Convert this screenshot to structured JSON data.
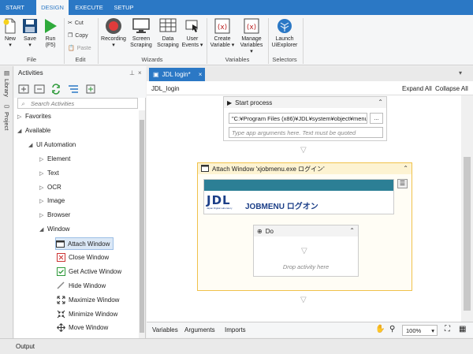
{
  "ribbon_tabs": [
    "START",
    "DESIGN",
    "EXECUTE",
    "SETUP"
  ],
  "active_tab": "DESIGN",
  "ribbon": {
    "new": "New",
    "save": "Save",
    "run_line1": "Run",
    "run_line2": "(F5)",
    "cut": "Cut",
    "copy": "Copy",
    "paste": "Paste",
    "recording": "Recording",
    "screen_scraping_1": "Screen",
    "screen_scraping_2": "Scraping",
    "data_scraping_1": "Data",
    "data_scraping_2": "Scraping",
    "user_events_1": "User",
    "user_events_2": "Events",
    "create_variable_1": "Create",
    "create_variable_2": "Variable",
    "manage_variables_1": "Manage",
    "manage_variables_2": "Variables",
    "launch_1": "Launch",
    "launch_2": "UiExplorer",
    "groups": {
      "file": "File",
      "edit": "Edit",
      "wizards": "Wizards",
      "variables": "Variables",
      "selectors": "Selectors"
    }
  },
  "side_tabs": {
    "library": "Library",
    "project": "Project"
  },
  "activities": {
    "title": "Activities",
    "search_placeholder": "Search Activities",
    "tree": {
      "favorites": "Favorites",
      "available": "Available",
      "ui_automation": "UI Automation",
      "element": "Element",
      "text": "Text",
      "ocr": "OCR",
      "image": "Image",
      "browser": "Browser",
      "window": "Window",
      "attach_window": "Attach Window",
      "close_window": "Close Window",
      "get_active_window": "Get Active Window",
      "hide_window": "Hide Window",
      "maximize_window": "Maximize Window",
      "minimize_window": "Minimize Window",
      "move_window": "Move Window"
    }
  },
  "document": {
    "tab": "JDL login*",
    "breadcrumb": "JDL_login",
    "expand_all": "Expand All",
    "collapse_all": "Collapse All",
    "start_process": {
      "title": "Start process",
      "path": "\"C:¥Program Files (x86)¥JDL¥system¥object¥menu",
      "browse": "...",
      "args_placeholder": "Type app arguments here. Text must be quoted"
    },
    "attach_window": {
      "title": "Attach Window 'xjobmenu.exe ログイン'",
      "logo_text": "JDL",
      "logo_sub": "Japan Digital Laboratory",
      "screen_title": "JOBMENU ログオン"
    },
    "do": {
      "title": "Do",
      "drop_hint": "Drop activity here"
    }
  },
  "footer": {
    "variables": "Variables",
    "arguments": "Arguments",
    "imports": "Imports",
    "zoom": "100%"
  },
  "output": "Output",
  "colors": {
    "accent": "#2b78c5",
    "attach_border": "#f0c24b",
    "attach_header": "#fdf3d2",
    "screen_bar": "#2c7f95"
  }
}
